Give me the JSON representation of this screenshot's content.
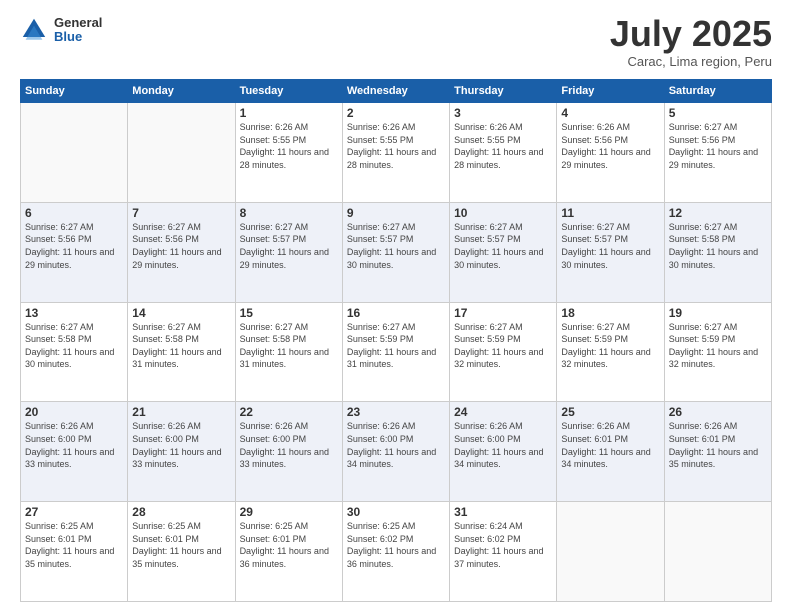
{
  "logo": {
    "general": "General",
    "blue": "Blue"
  },
  "title": {
    "month": "July 2025",
    "location": "Carac, Lima region, Peru"
  },
  "calendar": {
    "headers": [
      "Sunday",
      "Monday",
      "Tuesday",
      "Wednesday",
      "Thursday",
      "Friday",
      "Saturday"
    ],
    "weeks": [
      [
        {
          "day": "",
          "info": ""
        },
        {
          "day": "",
          "info": ""
        },
        {
          "day": "1",
          "info": "Sunrise: 6:26 AM\nSunset: 5:55 PM\nDaylight: 11 hours and 28 minutes."
        },
        {
          "day": "2",
          "info": "Sunrise: 6:26 AM\nSunset: 5:55 PM\nDaylight: 11 hours and 28 minutes."
        },
        {
          "day": "3",
          "info": "Sunrise: 6:26 AM\nSunset: 5:55 PM\nDaylight: 11 hours and 28 minutes."
        },
        {
          "day": "4",
          "info": "Sunrise: 6:26 AM\nSunset: 5:56 PM\nDaylight: 11 hours and 29 minutes."
        },
        {
          "day": "5",
          "info": "Sunrise: 6:27 AM\nSunset: 5:56 PM\nDaylight: 11 hours and 29 minutes."
        }
      ],
      [
        {
          "day": "6",
          "info": "Sunrise: 6:27 AM\nSunset: 5:56 PM\nDaylight: 11 hours and 29 minutes."
        },
        {
          "day": "7",
          "info": "Sunrise: 6:27 AM\nSunset: 5:56 PM\nDaylight: 11 hours and 29 minutes."
        },
        {
          "day": "8",
          "info": "Sunrise: 6:27 AM\nSunset: 5:57 PM\nDaylight: 11 hours and 29 minutes."
        },
        {
          "day": "9",
          "info": "Sunrise: 6:27 AM\nSunset: 5:57 PM\nDaylight: 11 hours and 30 minutes."
        },
        {
          "day": "10",
          "info": "Sunrise: 6:27 AM\nSunset: 5:57 PM\nDaylight: 11 hours and 30 minutes."
        },
        {
          "day": "11",
          "info": "Sunrise: 6:27 AM\nSunset: 5:57 PM\nDaylight: 11 hours and 30 minutes."
        },
        {
          "day": "12",
          "info": "Sunrise: 6:27 AM\nSunset: 5:58 PM\nDaylight: 11 hours and 30 minutes."
        }
      ],
      [
        {
          "day": "13",
          "info": "Sunrise: 6:27 AM\nSunset: 5:58 PM\nDaylight: 11 hours and 30 minutes."
        },
        {
          "day": "14",
          "info": "Sunrise: 6:27 AM\nSunset: 5:58 PM\nDaylight: 11 hours and 31 minutes."
        },
        {
          "day": "15",
          "info": "Sunrise: 6:27 AM\nSunset: 5:58 PM\nDaylight: 11 hours and 31 minutes."
        },
        {
          "day": "16",
          "info": "Sunrise: 6:27 AM\nSunset: 5:59 PM\nDaylight: 11 hours and 31 minutes."
        },
        {
          "day": "17",
          "info": "Sunrise: 6:27 AM\nSunset: 5:59 PM\nDaylight: 11 hours and 32 minutes."
        },
        {
          "day": "18",
          "info": "Sunrise: 6:27 AM\nSunset: 5:59 PM\nDaylight: 11 hours and 32 minutes."
        },
        {
          "day": "19",
          "info": "Sunrise: 6:27 AM\nSunset: 5:59 PM\nDaylight: 11 hours and 32 minutes."
        }
      ],
      [
        {
          "day": "20",
          "info": "Sunrise: 6:26 AM\nSunset: 6:00 PM\nDaylight: 11 hours and 33 minutes."
        },
        {
          "day": "21",
          "info": "Sunrise: 6:26 AM\nSunset: 6:00 PM\nDaylight: 11 hours and 33 minutes."
        },
        {
          "day": "22",
          "info": "Sunrise: 6:26 AM\nSunset: 6:00 PM\nDaylight: 11 hours and 33 minutes."
        },
        {
          "day": "23",
          "info": "Sunrise: 6:26 AM\nSunset: 6:00 PM\nDaylight: 11 hours and 34 minutes."
        },
        {
          "day": "24",
          "info": "Sunrise: 6:26 AM\nSunset: 6:00 PM\nDaylight: 11 hours and 34 minutes."
        },
        {
          "day": "25",
          "info": "Sunrise: 6:26 AM\nSunset: 6:01 PM\nDaylight: 11 hours and 34 minutes."
        },
        {
          "day": "26",
          "info": "Sunrise: 6:26 AM\nSunset: 6:01 PM\nDaylight: 11 hours and 35 minutes."
        }
      ],
      [
        {
          "day": "27",
          "info": "Sunrise: 6:25 AM\nSunset: 6:01 PM\nDaylight: 11 hours and 35 minutes."
        },
        {
          "day": "28",
          "info": "Sunrise: 6:25 AM\nSunset: 6:01 PM\nDaylight: 11 hours and 35 minutes."
        },
        {
          "day": "29",
          "info": "Sunrise: 6:25 AM\nSunset: 6:01 PM\nDaylight: 11 hours and 36 minutes."
        },
        {
          "day": "30",
          "info": "Sunrise: 6:25 AM\nSunset: 6:02 PM\nDaylight: 11 hours and 36 minutes."
        },
        {
          "day": "31",
          "info": "Sunrise: 6:24 AM\nSunset: 6:02 PM\nDaylight: 11 hours and 37 minutes."
        },
        {
          "day": "",
          "info": ""
        },
        {
          "day": "",
          "info": ""
        }
      ]
    ]
  }
}
